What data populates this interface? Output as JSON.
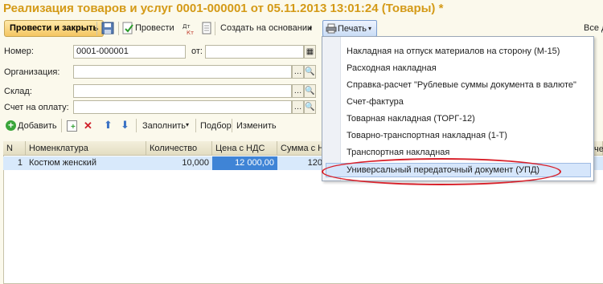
{
  "window": {
    "title": "Реализация товаров и услуг 0001-000001 от 05.11.2013 13:01:24 (Товары)",
    "modified_mark": "*"
  },
  "toolbar": {
    "post_close": "Провести и закрыть",
    "post": "Провести",
    "create_based": "Создать на основании",
    "print": "Печать",
    "all_actions": "Все д"
  },
  "form": {
    "number_label": "Номер:",
    "number_value": "0001-000001",
    "date_label": "от:",
    "org_label": "Организация:",
    "warehouse_label": "Склад:",
    "invoice_label": "Счет на оплату:"
  },
  "table_toolbar": {
    "add": "Добавить",
    "fill": "Заполнить",
    "select": "Подбор",
    "change": "Изменить"
  },
  "table": {
    "columns": [
      "N",
      "Номенклатура",
      "Количество",
      "Цена с НДС",
      "Сумма с Н"
    ],
    "rows": [
      {
        "n": "1",
        "item": "Костюм женский",
        "qty": "10,000",
        "price": "12 000,00",
        "sum": "120"
      }
    ],
    "right_cut": "чет"
  },
  "print_menu": [
    "Накладная на отпуск материалов на сторону (М-15)",
    "Расходная накладная",
    "Справка-расчет \"Рублевые суммы документа в валюте\"",
    "Счет-фактура",
    "Товарная накладная (ТОРГ-12)",
    "Товарно-транспортная накладная (1-Т)",
    "Транспортная накладная",
    "Универсальный передаточный документ (УПД)"
  ],
  "colors": {
    "title": "#d49a17",
    "highlight": "#d6e6fb",
    "annotation": "#d8202a"
  }
}
